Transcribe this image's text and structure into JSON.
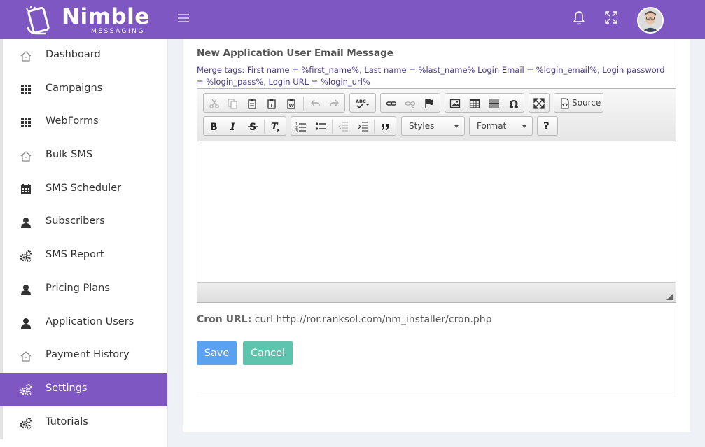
{
  "brand": {
    "name": "Nimble",
    "sub": "MESSAGING",
    "color": "#7e57c2"
  },
  "header": {
    "menu_icon": "hamburger-icon",
    "notification_icon": "bell-icon",
    "fullscreen_icon": "expand-icon",
    "avatar_icon": "user-avatar"
  },
  "sidebar": {
    "items": [
      {
        "label": "Dashboard",
        "icon": "home-icon"
      },
      {
        "label": "Campaigns",
        "icon": "grid-icon"
      },
      {
        "label": "WebForms",
        "icon": "grid-icon"
      },
      {
        "label": "Bulk SMS",
        "icon": "home-icon"
      },
      {
        "label": "SMS Scheduler",
        "icon": "calendar-icon"
      },
      {
        "label": "Subscribers",
        "icon": "user-icon"
      },
      {
        "label": "SMS Report",
        "icon": "gears-icon"
      },
      {
        "label": "Pricing Plans",
        "icon": "user-icon"
      },
      {
        "label": "Application Users",
        "icon": "user-icon"
      },
      {
        "label": "Payment History",
        "icon": "home-icon"
      },
      {
        "label": "Settings",
        "icon": "gears-icon",
        "active": true
      },
      {
        "label": "Tutorials",
        "icon": "gears-icon"
      }
    ]
  },
  "form": {
    "title": "New Application User Email Message",
    "merge_tags": "Merge tags: First name = %first_name%, Last name = %last_name% Login Email = %login_email%, Login password = %login_pass%, Login URL = %login_url%",
    "editor": {
      "source_label": "Source",
      "styles_label": "Styles",
      "format_label": "Format",
      "help_label": "?",
      "content": ""
    },
    "cron_label": "Cron URL:",
    "cron_value": " curl http://ror.ranksol.com/nm_installer/cron.php",
    "save_label": "Save",
    "cancel_label": "Cancel"
  }
}
